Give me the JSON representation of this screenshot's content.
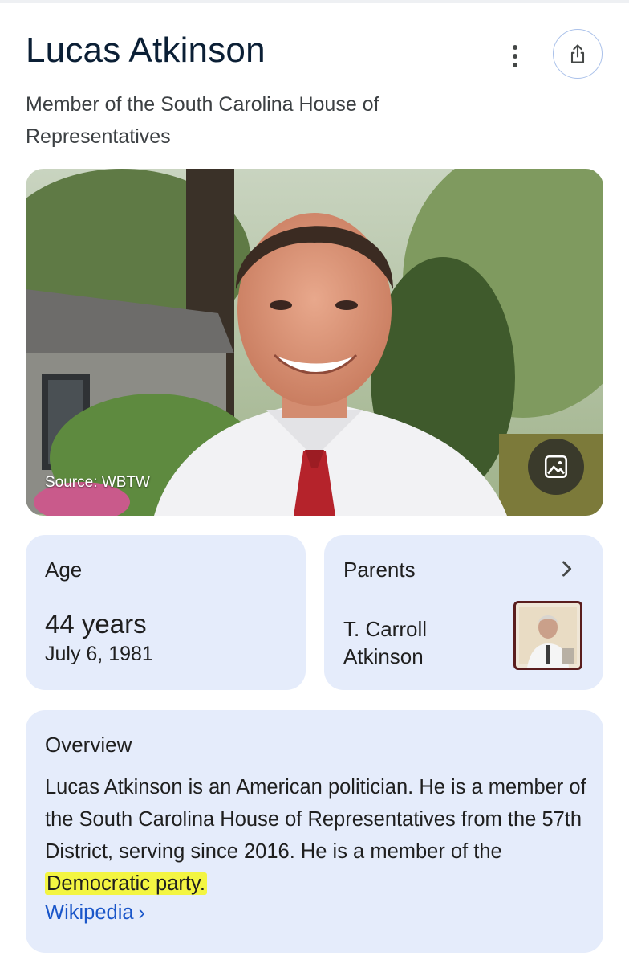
{
  "header": {
    "title": "Lucas Atkinson",
    "subtitle": "Member of the South Carolina House of Representatives"
  },
  "photo": {
    "source_label": "Source: WBTW"
  },
  "age_card": {
    "label": "Age",
    "value": "44 years",
    "birth_date": "July 6, 1981"
  },
  "parents_card": {
    "label": "Parents",
    "name_line1": "T. Carroll",
    "name_line2": "Atkinson"
  },
  "overview_card": {
    "label": "Overview",
    "text_before_highlight": "Lucas Atkinson is an American politician. He is a member of the South Carolina House of Representatives from the 57th District, serving since 2016. He is a member of the ",
    "highlighted_text": "Democratic party.",
    "link_label": "Wikipedia",
    "link_chevron": "›"
  },
  "icons": [
    "more-vert-icon",
    "share-icon",
    "image-icon",
    "chevron-right-icon"
  ],
  "colors": {
    "card_background": "#e5ecfb",
    "title": "#0b1f35",
    "link": "#1a56c9",
    "highlight": "#f3f542"
  }
}
